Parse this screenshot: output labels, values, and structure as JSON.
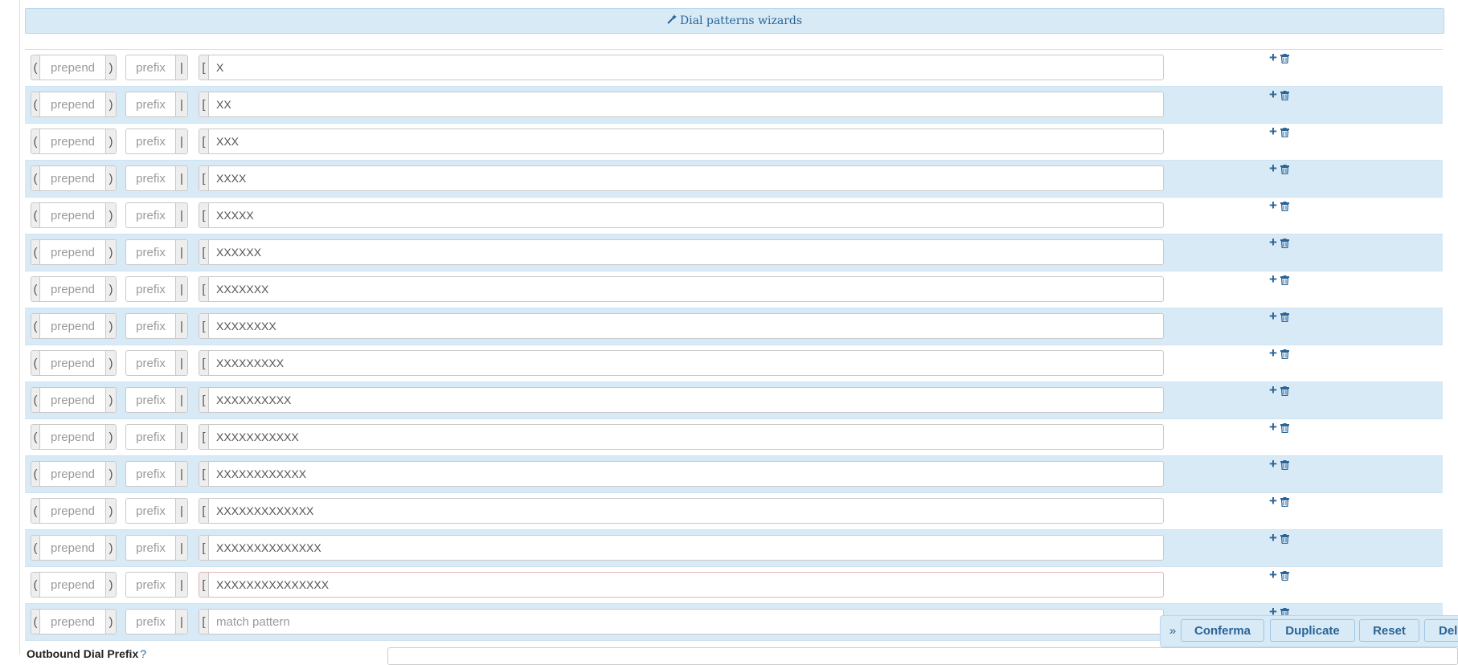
{
  "wizard": {
    "label": "Dial patterns wizards"
  },
  "placeholders": {
    "prepend": "prepend",
    "prefix": "prefix",
    "match": "match pattern"
  },
  "addons": {
    "open_paren": "(",
    "close_paren": ")",
    "pipe": "|",
    "open_bracket": "["
  },
  "patterns": [
    "X",
    "XX",
    "XXX",
    "XXXX",
    "XXXXX",
    "XXXXXX",
    "XXXXXXX",
    "XXXXXXXX",
    "XXXXXXXXX",
    "XXXXXXXXXX",
    "XXXXXXXXXXX",
    "XXXXXXXXXXXX",
    "XXXXXXXXXXXXX",
    "XXXXXXXXXXXXXX",
    "XXXXXXXXXXXXXXX",
    ""
  ],
  "icons": {
    "add": "plus-icon",
    "delete": "trash-icon",
    "expand": "double-chevron-right-icon",
    "wizard": "magic-wand-icon"
  },
  "footer": {
    "buttons": [
      "Conferma",
      "Duplicate",
      "Reset",
      "Delete"
    ]
  },
  "field": {
    "label": "Outbound Dial Prefix",
    "help": "?"
  },
  "colors": {
    "accent": "#2a6496",
    "row_alt": "#d9eaf7"
  }
}
